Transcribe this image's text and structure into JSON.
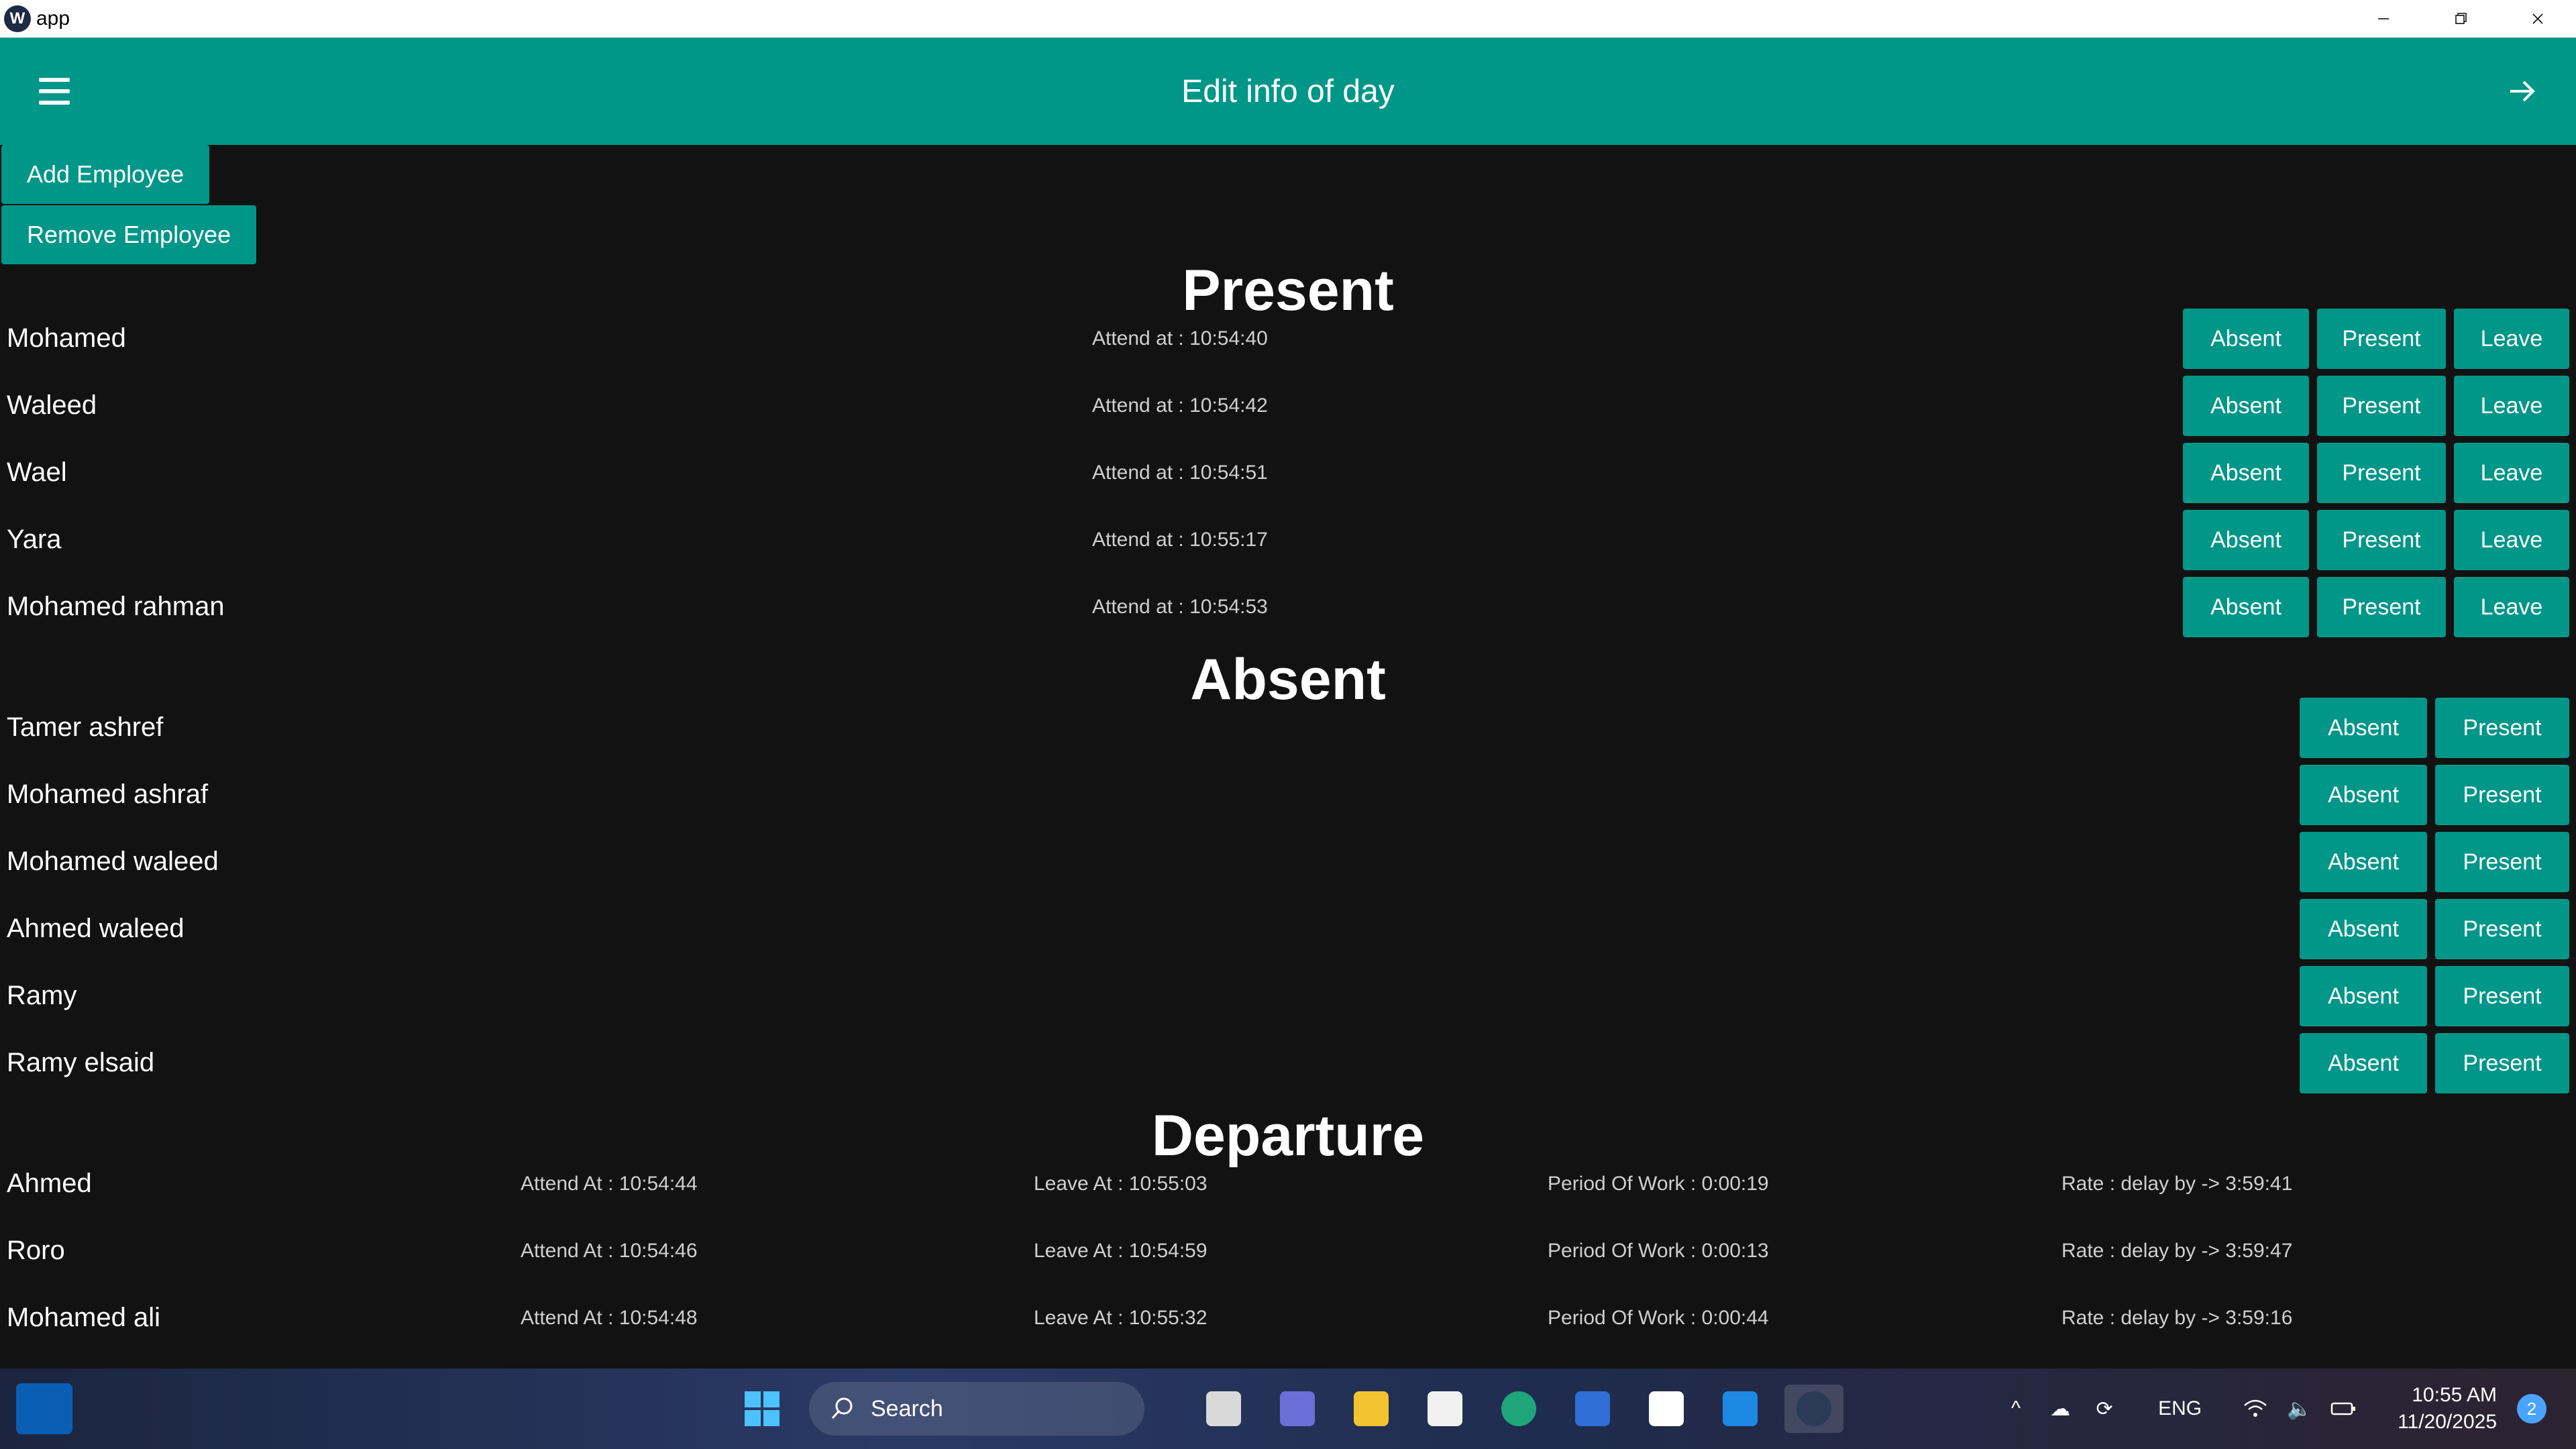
{
  "window": {
    "title": "app",
    "app_icon_glyph": "W",
    "controls": [
      "minimize-icon",
      "restore-icon",
      "close-icon"
    ]
  },
  "appbar": {
    "title": "Edit info of day",
    "menu_icon": "hamburger-menu-icon",
    "forward_icon": "arrow-right-icon",
    "color": "#009688"
  },
  "actions": {
    "add_employee": "Add Employee",
    "remove_employee": "Remove Employee"
  },
  "present": {
    "title": "Present",
    "buttons": {
      "absent": "Absent",
      "present": "Present",
      "leave": "Leave"
    },
    "rows": [
      {
        "name": "Mohamed",
        "attend": "Attend at : 10:54:40"
      },
      {
        "name": "Waleed",
        "attend": "Attend at : 10:54:42"
      },
      {
        "name": "Wael",
        "attend": "Attend at : 10:54:51"
      },
      {
        "name": "Yara",
        "attend": "Attend at : 10:55:17"
      },
      {
        "name": "Mohamed rahman",
        "attend": "Attend at : 10:54:53"
      }
    ]
  },
  "absent": {
    "title": "Absent",
    "buttons": {
      "absent": "Absent",
      "present": "Present"
    },
    "rows": [
      {
        "name": "Tamer ashref"
      },
      {
        "name": "Mohamed ashraf"
      },
      {
        "name": "Mohamed waleed"
      },
      {
        "name": "Ahmed waleed"
      },
      {
        "name": "Ramy"
      },
      {
        "name": "Ramy elsaid"
      }
    ]
  },
  "departure": {
    "title": "Departure",
    "rows": [
      {
        "name": "Ahmed",
        "attend": "Attend At : 10:54:44",
        "leave": "Leave At : 10:55:03",
        "period": "Period Of Work : 0:00:19",
        "rate": "Rate : delay by -> 3:59:41"
      },
      {
        "name": "Roro",
        "attend": "Attend At : 10:54:46",
        "leave": "Leave At : 10:54:59",
        "period": "Period Of Work : 0:00:13",
        "rate": "Rate : delay by -> 3:59:47"
      },
      {
        "name": "Mohamed ali",
        "attend": "Attend At : 10:54:48",
        "leave": "Leave At : 10:55:32",
        "period": "Period Of Work : 0:00:44",
        "rate": "Rate : delay by -> 3:59:16"
      }
    ]
  },
  "taskbar": {
    "search_label": "Search",
    "language": "ENG",
    "time": "10:55 AM",
    "date": "11/20/2025",
    "notification_count": "2",
    "apps": [
      "widgets-icon",
      "windows-start-icon",
      "file-icon",
      "teams-icon",
      "file-explorer-icon",
      "store-icon",
      "edge-icon",
      "app-icon",
      "notion-icon",
      "vscode-icon",
      "flutter-app-icon"
    ]
  }
}
